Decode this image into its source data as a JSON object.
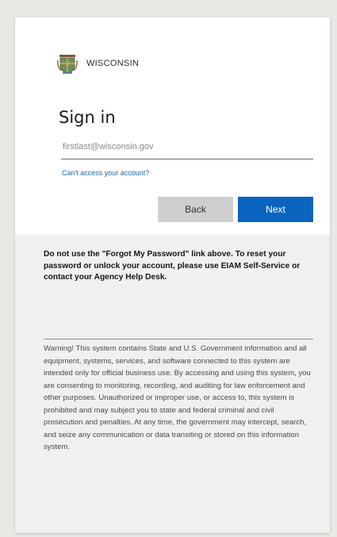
{
  "org": {
    "name": "WISCONSIN",
    "logo_icon": "wisconsin-seal-icon"
  },
  "signin": {
    "title": "Sign in",
    "email_placeholder": "firstlast@wisconsin.gov",
    "email_value": "",
    "cant_access_link": "Can't access your account?"
  },
  "buttons": {
    "back_label": "Back",
    "next_label": "Next"
  },
  "colors": {
    "next_button": "#0b64c0",
    "back_button": "#cfcfcf",
    "link": "#1a66b8"
  },
  "footer": {
    "notice": "Do not use the \"Forgot My Password\" link above. To reset your password or unlock your account, please use EIAM Self-Service or contact your Agency Help Desk.",
    "warning": "Warning! This system contains State and U.S. Government information and all equipment, systems, services, and software connected to this system are intended only for official business use. By accessing and using this system, you are consenting to monitoring, recording, and auditing for law enforcement and other purposes. Unauthorized or improper use, or access to, this system is prohibited and may subject you to state and federal criminal and civil prosecution and penalties. At any time, the government may intercept, search, and seize any communication or data transiting or stored on this information system."
  }
}
